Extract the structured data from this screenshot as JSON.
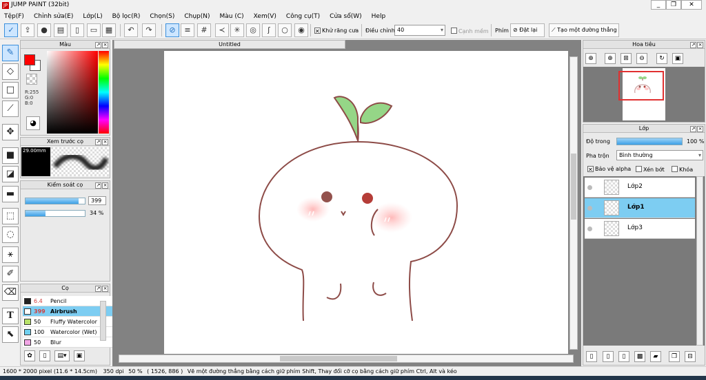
{
  "app": {
    "title": "JUMP PAINT (32bit)",
    "logo": "JP"
  },
  "window": {
    "minimize": "_",
    "restore": "❐",
    "close": "✕"
  },
  "menu": [
    "Tệp(F)",
    "Chỉnh sửa(E)",
    "Lớp(L)",
    "Bộ lọc(R)",
    "Chọn(S)",
    "Chụp(N)",
    "Màu (C)",
    "Xem(V)",
    "Công cụ(T)",
    "Cửa sổ(W)",
    "Help"
  ],
  "toolbar": {
    "antialias_label": "Khử răng cưa",
    "adjust_label": "Điều chỉnh",
    "adjust_value": "40",
    "smooth_label": "Cạnh mềm",
    "keys_label": "Phím",
    "reset_label": "Đặt lại",
    "straight_line_label": "Tạo một đường thẳng"
  },
  "color_panel": {
    "title": "Màu",
    "r": "R:255",
    "g": "G:0",
    "b": "B:0",
    "fg": "#ff0000",
    "bg": "#ffffff"
  },
  "brush_preview_panel": {
    "title": "Xem trước cọ",
    "size": "29.00mm"
  },
  "brush_control_panel": {
    "title": "Kiểm soát cọ",
    "size_value": "399",
    "opacity_value": "34 %",
    "size_fraction": 0.9,
    "opacity_fraction": 0.34
  },
  "brush_panel": {
    "title": "Cọ",
    "brushes": [
      {
        "size": "6.4",
        "name": "Pencil",
        "color": "#222222",
        "size_color": "#d04040"
      },
      {
        "size": "399",
        "name": "Airbrush",
        "color": "#ffffff",
        "size_color": "#d04040"
      },
      {
        "size": "50",
        "name": "Fluffy Watercolor",
        "color": "#b8e26a",
        "size_color": "#000000"
      },
      {
        "size": "100",
        "name": "Watercolor (Wet)",
        "color": "#6fd0ef",
        "size_color": "#000000"
      },
      {
        "size": "50",
        "name": "Blur",
        "color": "#f2a6e6",
        "size_color": "#000000"
      }
    ]
  },
  "canvas": {
    "tab_title": "Untitled"
  },
  "navigator_panel": {
    "title": "Hoa tiêu"
  },
  "layer_panel": {
    "title": "Lớp",
    "opacity_label": "Độ trong",
    "opacity_value": "100 %",
    "blend_label": "Pha trộn",
    "blend_value": "Bình thường",
    "protect_alpha": "Bảo vệ alpha",
    "clipping": "Xén bớt",
    "lock": "Khóa",
    "layers": [
      {
        "name": "Lớp2",
        "selected": false
      },
      {
        "name": "Lớp1",
        "selected": true
      },
      {
        "name": "Lớp3",
        "selected": false
      }
    ]
  },
  "status": {
    "size": "1600 * 2000 pixel",
    "physical": "(11.6 * 14.5cm)",
    "dpi": "350 dpi",
    "zoom": "50 %",
    "coords": "( 1526, 886 )",
    "hint": "Vẽ một đường thẳng bằng cách giữ phím Shift, Thay đổi cỡ cọ bằng cách giữ phím Ctrl, Alt và kéo"
  }
}
